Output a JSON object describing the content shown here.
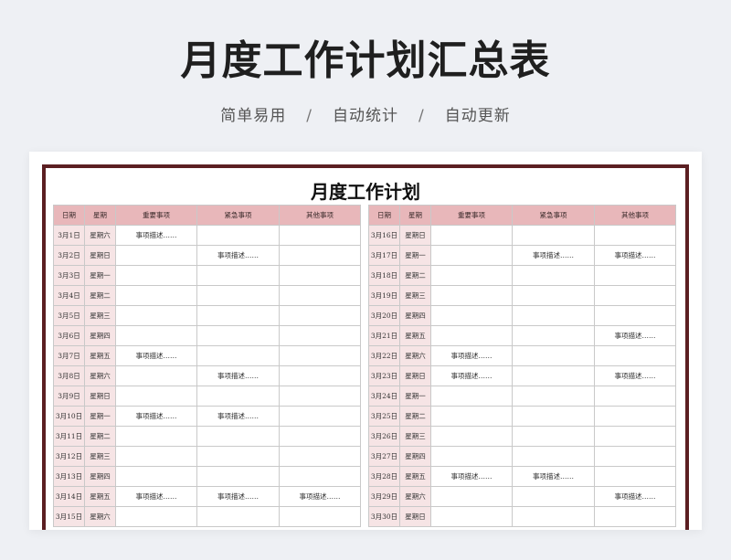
{
  "header": {
    "title": "月度工作计划汇总表",
    "features": [
      "简单易用",
      "自动统计",
      "自动更新"
    ],
    "separator": "/"
  },
  "sheet": {
    "title": "月度工作计划",
    "columns": [
      "日期",
      "星期",
      "重要事项",
      "紧急事项",
      "其他事项"
    ],
    "left_rows": [
      {
        "date": "3月1日",
        "weekday": "星期六",
        "important": "事项描述……",
        "urgent": "",
        "other": ""
      },
      {
        "date": "3月2日",
        "weekday": "星期日",
        "important": "",
        "urgent": "事项描述……",
        "other": ""
      },
      {
        "date": "3月3日",
        "weekday": "星期一",
        "important": "",
        "urgent": "",
        "other": ""
      },
      {
        "date": "3月4日",
        "weekday": "星期二",
        "important": "",
        "urgent": "",
        "other": ""
      },
      {
        "date": "3月5日",
        "weekday": "星期三",
        "important": "",
        "urgent": "",
        "other": ""
      },
      {
        "date": "3月6日",
        "weekday": "星期四",
        "important": "",
        "urgent": "",
        "other": ""
      },
      {
        "date": "3月7日",
        "weekday": "星期五",
        "important": "事项描述……",
        "urgent": "",
        "other": ""
      },
      {
        "date": "3月8日",
        "weekday": "星期六",
        "important": "",
        "urgent": "事项描述……",
        "other": ""
      },
      {
        "date": "3月9日",
        "weekday": "星期日",
        "important": "",
        "urgent": "",
        "other": ""
      },
      {
        "date": "3月10日",
        "weekday": "星期一",
        "important": "事项描述……",
        "urgent": "事项描述……",
        "other": ""
      },
      {
        "date": "3月11日",
        "weekday": "星期二",
        "important": "",
        "urgent": "",
        "other": ""
      },
      {
        "date": "3月12日",
        "weekday": "星期三",
        "important": "",
        "urgent": "",
        "other": ""
      },
      {
        "date": "3月13日",
        "weekday": "星期四",
        "important": "",
        "urgent": "",
        "other": ""
      },
      {
        "date": "3月14日",
        "weekday": "星期五",
        "important": "事项描述……",
        "urgent": "事项描述……",
        "other": "事项描述……"
      },
      {
        "date": "3月15日",
        "weekday": "星期六",
        "important": "",
        "urgent": "",
        "other": ""
      }
    ],
    "right_rows": [
      {
        "date": "3月16日",
        "weekday": "星期日",
        "important": "",
        "urgent": "",
        "other": ""
      },
      {
        "date": "3月17日",
        "weekday": "星期一",
        "important": "",
        "urgent": "事项描述……",
        "other": "事项描述……"
      },
      {
        "date": "3月18日",
        "weekday": "星期二",
        "important": "",
        "urgent": "",
        "other": ""
      },
      {
        "date": "3月19日",
        "weekday": "星期三",
        "important": "",
        "urgent": "",
        "other": ""
      },
      {
        "date": "3月20日",
        "weekday": "星期四",
        "important": "",
        "urgent": "",
        "other": ""
      },
      {
        "date": "3月21日",
        "weekday": "星期五",
        "important": "",
        "urgent": "",
        "other": "事项描述……"
      },
      {
        "date": "3月22日",
        "weekday": "星期六",
        "important": "事项描述……",
        "urgent": "",
        "other": ""
      },
      {
        "date": "3月23日",
        "weekday": "星期日",
        "important": "事项描述……",
        "urgent": "",
        "other": "事项描述……"
      },
      {
        "date": "3月24日",
        "weekday": "星期一",
        "important": "",
        "urgent": "",
        "other": ""
      },
      {
        "date": "3月25日",
        "weekday": "星期二",
        "important": "",
        "urgent": "",
        "other": ""
      },
      {
        "date": "3月26日",
        "weekday": "星期三",
        "important": "",
        "urgent": "",
        "other": ""
      },
      {
        "date": "3月27日",
        "weekday": "星期四",
        "important": "",
        "urgent": "",
        "other": ""
      },
      {
        "date": "3月28日",
        "weekday": "星期五",
        "important": "事项描述……",
        "urgent": "事项描述……",
        "other": ""
      },
      {
        "date": "3月29日",
        "weekday": "星期六",
        "important": "",
        "urgent": "",
        "other": "事项描述……"
      },
      {
        "date": "3月30日",
        "weekday": "星期日",
        "important": "",
        "urgent": "",
        "other": ""
      }
    ]
  },
  "colors": {
    "header_fill": "#e8b7ba",
    "date_fill": "#f6e4e5",
    "frame": "#5b1f22",
    "background": "#eef0f4"
  }
}
